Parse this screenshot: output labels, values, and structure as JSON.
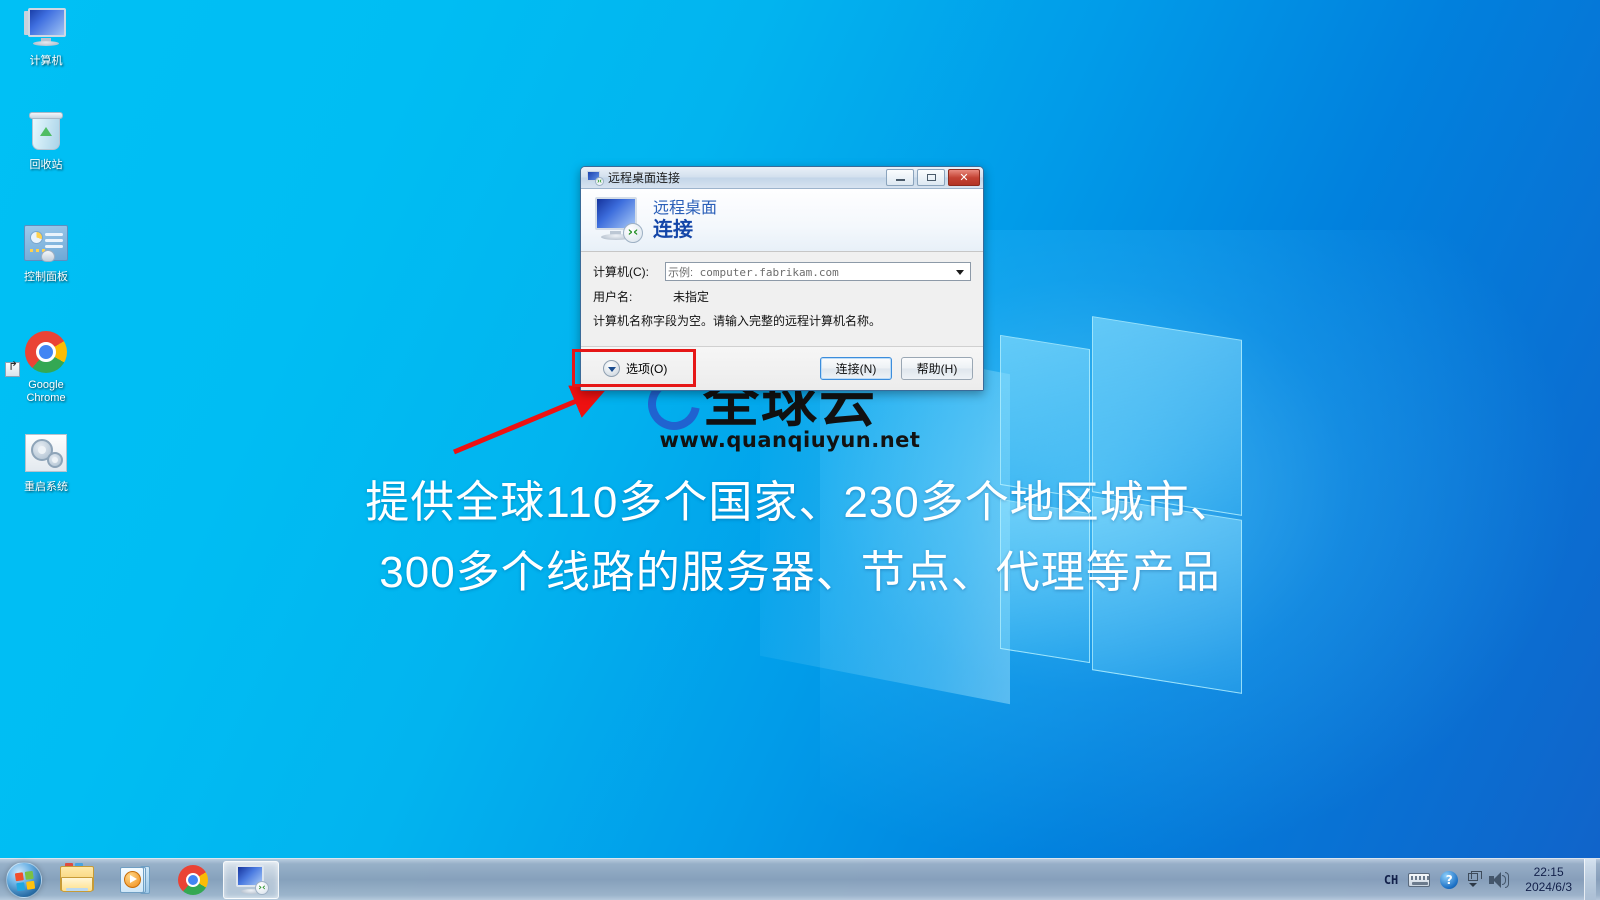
{
  "desktop": {
    "icons": [
      {
        "label": "计算机",
        "icon": "computer-icon"
      },
      {
        "label": "回收站",
        "icon": "recycle-bin-icon"
      },
      {
        "label": "控制面板",
        "icon": "control-panel-icon"
      },
      {
        "label": "Google\nChrome",
        "label_line1": "Google",
        "label_line2": "Chrome",
        "icon": "chrome-icon"
      },
      {
        "label": "重启系统",
        "icon": "restart-system-icon"
      }
    ]
  },
  "watermark": {
    "logo": "全球云",
    "url": "www.quanqiuyun.net",
    "line1": "提供全球110多个国家、230多个地区城市、",
    "line2": "300多个线路的服务器、节点、代理等产品",
    "accent_color": "#2850c8"
  },
  "dialog": {
    "titlebar": {
      "title": "远程桌面连接",
      "minimize_label": "最小化",
      "maximize_label": "最大化",
      "close_label": "关闭"
    },
    "header": {
      "title_line1": "远程桌面",
      "title_line2": "连接",
      "title_color": "#1446a8"
    },
    "fields": {
      "computer_label": "计算机(C):",
      "computer_placeholder_prefix": "示例:",
      "computer_placeholder_value": " computer.fabrikam.com",
      "computer_value": "",
      "username_label": "用户名:",
      "username_value": "未指定",
      "note": "计算机名称字段为空。请输入完整的远程计算机名称。"
    },
    "footer": {
      "options_label": "选项(O)",
      "connect_label": "连接(N)",
      "help_label": "帮助(H)"
    }
  },
  "annotation": {
    "highlight_color": "#e61717",
    "target": "选项(O)"
  },
  "taskbar": {
    "start_label": "开始",
    "items": [
      {
        "name": "windows-explorer",
        "label": "Windows 资源管理器",
        "active": false
      },
      {
        "name": "windows-media-player",
        "label": "Windows Media Player",
        "active": false
      },
      {
        "name": "google-chrome",
        "label": "Google Chrome",
        "active": false
      },
      {
        "name": "remote-desktop-connection",
        "label": "远程桌面连接",
        "active": true
      }
    ],
    "tray": {
      "ime_label": "CH",
      "keyboard_label": "输入法",
      "help_label": "帮助",
      "expander_label": "显示隐藏的图标",
      "volume_label": "音量",
      "time": "22:15",
      "date": "2024/6/3"
    }
  }
}
